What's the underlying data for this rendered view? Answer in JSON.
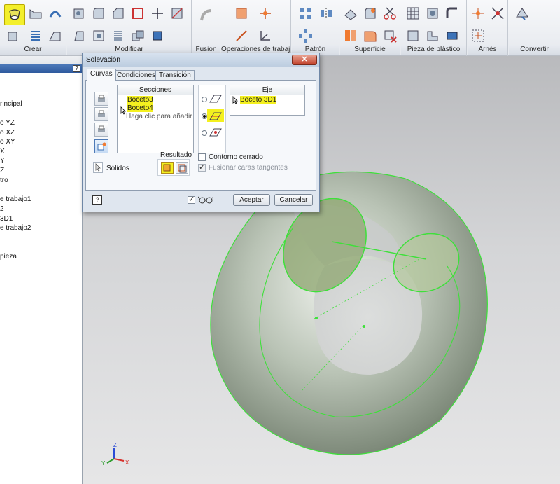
{
  "ribbon": {
    "groups": [
      {
        "label": "Crear"
      },
      {
        "label": "Modificar"
      },
      {
        "label": "Fusion"
      },
      {
        "label": "Operaciones de trabajo"
      },
      {
        "label": "Patrón"
      },
      {
        "label": "Superficie"
      },
      {
        "label": "Pieza de plástico"
      },
      {
        "label": "Arnés"
      },
      {
        "label": "Convertir"
      }
    ],
    "highlighted_tool_icon": "loft-icon"
  },
  "browser": {
    "items": [
      "rincipal",
      "o YZ",
      "o XZ",
      "o XY",
      "X",
      "Y",
      "Z",
      "tro",
      "",
      "e trabajo1",
      "2",
      "3D1",
      "e trabajo2",
      "",
      "",
      "pieza"
    ]
  },
  "dialog": {
    "title": "Solevación",
    "tabs": [
      "Curvas",
      "Condiciones",
      "Transición"
    ],
    "active_tab": "Curvas",
    "sections": {
      "header": "Secciones",
      "items": [
        "Boceto3",
        "Boceto4"
      ],
      "add_hint": "Haga clic para añadir"
    },
    "axis": {
      "header": "Eje",
      "items": [
        "Boceto 3D1"
      ]
    },
    "solids_label": "Sólidos",
    "result_label": "Resultado",
    "closed_loop_label": "Contorno cerrado",
    "merge_tangent_label": "Fusionar caras tangentes",
    "ok_label": "Aceptar",
    "cancel_label": "Cancelar",
    "closed_loop_checked": false,
    "merge_tangent_checked": true,
    "preview_checked": true,
    "highlight_color": "#f4f01f"
  },
  "viewport": {
    "triad": {
      "x": "X",
      "y": "Y",
      "z": "Z"
    },
    "wire_color": "#3ee03a",
    "body_color": "#9eaa9a"
  }
}
